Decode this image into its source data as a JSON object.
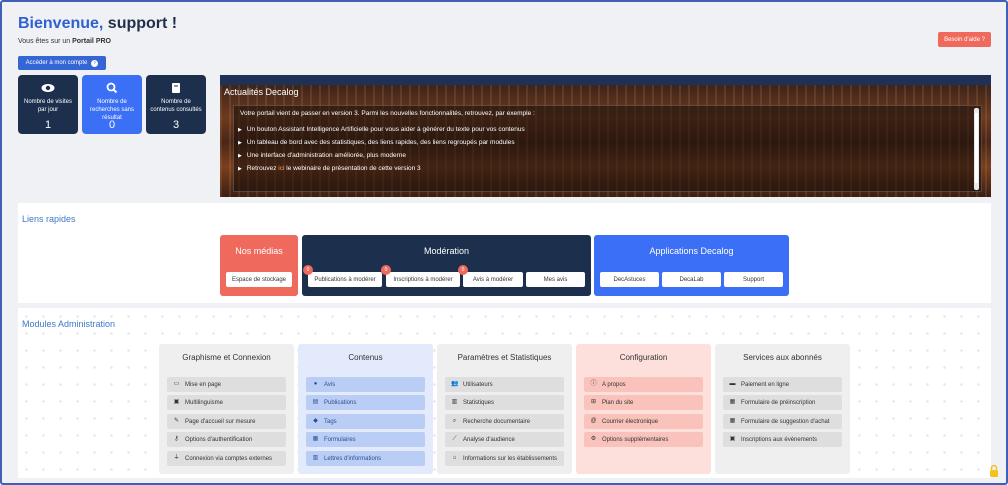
{
  "header": {
    "greeting": "Bienvenue,",
    "user": " support !",
    "portal_prefix": "Vous êtes sur un ",
    "portal_name": "Portail PRO",
    "account_button": "Accéder à mon compte",
    "help_button": "Besoin d'aide ?"
  },
  "stats": [
    {
      "icon": "eye-icon",
      "label": "Nombre de visites par jour",
      "value": "1"
    },
    {
      "icon": "search-icon",
      "label": "Nombre de recherches sans résultat",
      "value": "0"
    },
    {
      "icon": "book-icon",
      "label": "Nombre de contenus consultés",
      "value": "3"
    }
  ],
  "news": {
    "title": "Actualités Decalog",
    "intro": "Votre portail vient de passer en version 3. Parmi les nouvelles fonctionnalités, retrouvez, par exemple :",
    "items": [
      "Un bouton Assistant Intelligence Artificielle pour vous aider à générer du texte pour vos contenus",
      "Un tableau de bord avec des statistiques, des liens rapides, des liens regroupés par modules",
      "Une interface d'administration améliorée, plus moderne"
    ],
    "last_item_prefix": "Retrouvez ",
    "last_item_link": "ici",
    "last_item_suffix": " le webinaire de présentation de cette version 3"
  },
  "quick_links": {
    "title": "Liens rapides",
    "medias": {
      "title": "Nos médias",
      "buttons": [
        "Espace de stockage"
      ]
    },
    "moderation": {
      "title": "Modération",
      "buttons": [
        {
          "label": "Publications à modérer",
          "badge": "0"
        },
        {
          "label": "Inscriptions à modérer",
          "badge": "0"
        },
        {
          "label": "Avis à modérer",
          "badge": "0"
        },
        {
          "label": "Mes avis"
        }
      ]
    },
    "apps": {
      "title": "Applications Decalog",
      "buttons": [
        "DecAstuces",
        "DecaLab",
        "Support"
      ]
    }
  },
  "modules": {
    "title": "Modules Administration",
    "cards": [
      {
        "title": "Graphisme et Connexion",
        "items": [
          {
            "icon": "monitor-icon",
            "label": "Mise en page"
          },
          {
            "icon": "language-icon",
            "label": "Multilinguisme"
          },
          {
            "icon": "pencil-icon",
            "label": "Page d'accueil sur mesure"
          },
          {
            "icon": "key-icon",
            "label": "Options d'authentification"
          },
          {
            "icon": "plug-icon",
            "label": "Connexion via comptes externes"
          }
        ]
      },
      {
        "title": "Contenus",
        "items": [
          {
            "icon": "comments-icon",
            "label": "Avis"
          },
          {
            "icon": "file-icon",
            "label": "Publications"
          },
          {
            "icon": "tag-icon",
            "label": "Tags"
          },
          {
            "icon": "form-icon",
            "label": "Formulaires"
          },
          {
            "icon": "newsletter-icon",
            "label": "Lettres d'informations"
          }
        ]
      },
      {
        "title": "Paramètres et Statistiques",
        "items": [
          {
            "icon": "users-icon",
            "label": "Utilisateurs"
          },
          {
            "icon": "chart-icon",
            "label": "Statistiques"
          },
          {
            "icon": "search-icon",
            "label": "Recherche documentaire"
          },
          {
            "icon": "line-chart-icon",
            "label": "Analyse d'audience"
          },
          {
            "icon": "home-icon",
            "label": "Informations sur les établissements"
          }
        ]
      },
      {
        "title": "Configuration",
        "items": [
          {
            "icon": "info-icon",
            "label": "A propos"
          },
          {
            "icon": "sitemap-icon",
            "label": "Plan du site"
          },
          {
            "icon": "at-icon",
            "label": "Courrier électronique"
          },
          {
            "icon": "cog-icon",
            "label": "Options supplémentaires"
          }
        ]
      },
      {
        "title": "Services aux abonnés",
        "items": [
          {
            "icon": "money-icon",
            "label": "Paiement en ligne"
          },
          {
            "icon": "form-icon",
            "label": "Formulaire de préinscription"
          },
          {
            "icon": "form-icon",
            "label": "Formulaire de suggestion d'achat"
          },
          {
            "icon": "calendar-icon",
            "label": "Inscriptions aux évènements"
          }
        ]
      }
    ]
  },
  "colors": {
    "primary": "#3566d6",
    "dark": "#1c2f4d",
    "accent": "#ef6a5c",
    "link": "#3f78c9"
  }
}
